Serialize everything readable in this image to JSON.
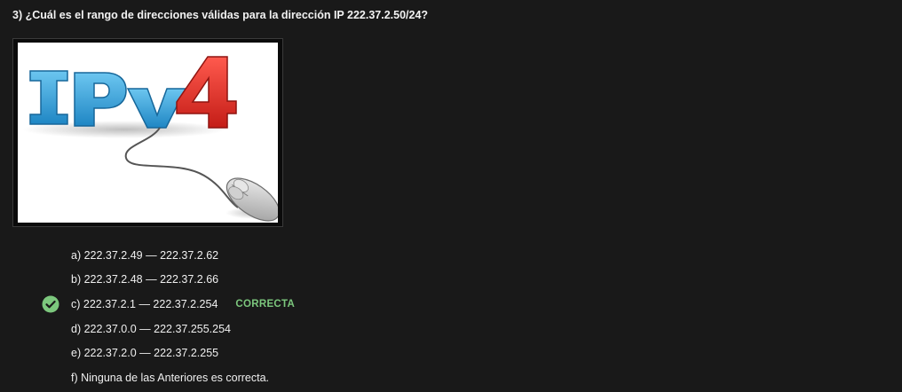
{
  "question": {
    "text": "3) ¿Cuál es el rango de direcciones válidas para la dirección IP 222.37.2.50/24?"
  },
  "image": {
    "logo_text_ip": "IPv",
    "logo_text_4": "4",
    "icon": "ipv4-mouse-illustration"
  },
  "options": [
    {
      "label": "a) 222.37.2.49 — 222.37.2.62"
    },
    {
      "label": "b) 222.37.2.48 — 222.37.2.66"
    },
    {
      "label": "c) 222.37.2.1 — 222.37.2.254",
      "badge": "CORRECTA"
    },
    {
      "label": "d) 222.37.0.0 — 222.37.255.254"
    },
    {
      "label": "e) 222.37.2.0 — 222.37.2.255"
    },
    {
      "label": "f) Ninguna de las Anteriores es correcta."
    }
  ],
  "colors": {
    "background": "#191919",
    "correct": "#7cc77d",
    "ip_blue": "#3fa9e0",
    "four_red": "#e8312b"
  }
}
